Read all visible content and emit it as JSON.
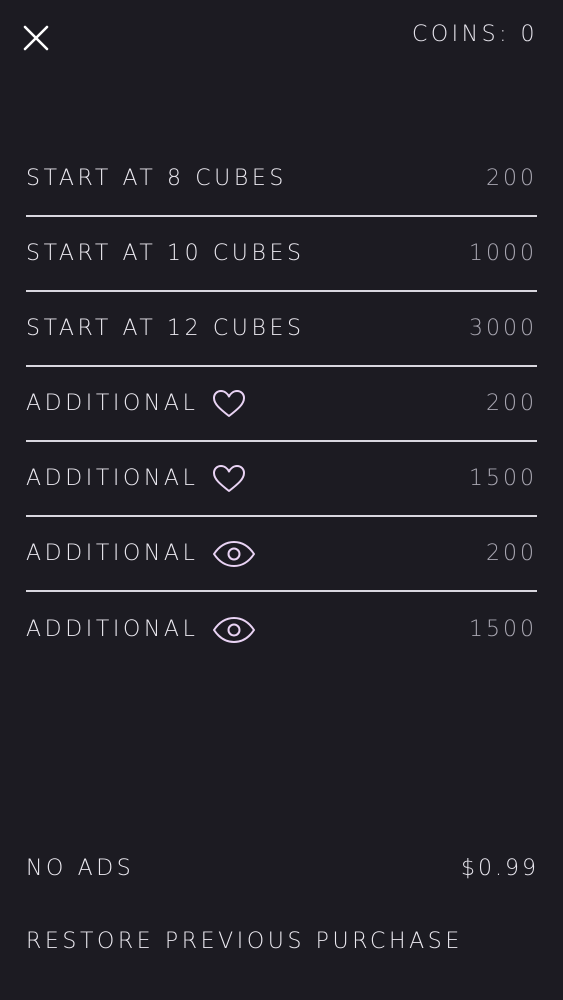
{
  "header": {
    "close_icon": "close-icon",
    "coins_label": "COINS: 0"
  },
  "shop": {
    "items": [
      {
        "label": "START AT 8 CUBES",
        "price": "200",
        "icon": ""
      },
      {
        "label": "START AT 10 CUBES",
        "price": "1000",
        "icon": ""
      },
      {
        "label": "START AT 12 CUBES",
        "price": "3000",
        "icon": ""
      },
      {
        "label": "ADDITIONAL",
        "price": "200",
        "icon": "heart-icon"
      },
      {
        "label": "ADDITIONAL",
        "price": "1500",
        "icon": "heart-icon"
      },
      {
        "label": "ADDITIONAL",
        "price": "200",
        "icon": "eye-icon"
      },
      {
        "label": "ADDITIONAL",
        "price": "1500",
        "icon": "eye-icon"
      }
    ]
  },
  "no_ads": {
    "label": "NO ADS",
    "price": "$0.99"
  },
  "restore": {
    "label": "RESTORE PREVIOUS PURCHASE"
  },
  "colors": {
    "background": "#1c1b22",
    "text": "#e6e4ec",
    "price": "#a9a7b2",
    "divider": "#d9d7df",
    "icon_accent": "#e9d3f4"
  }
}
